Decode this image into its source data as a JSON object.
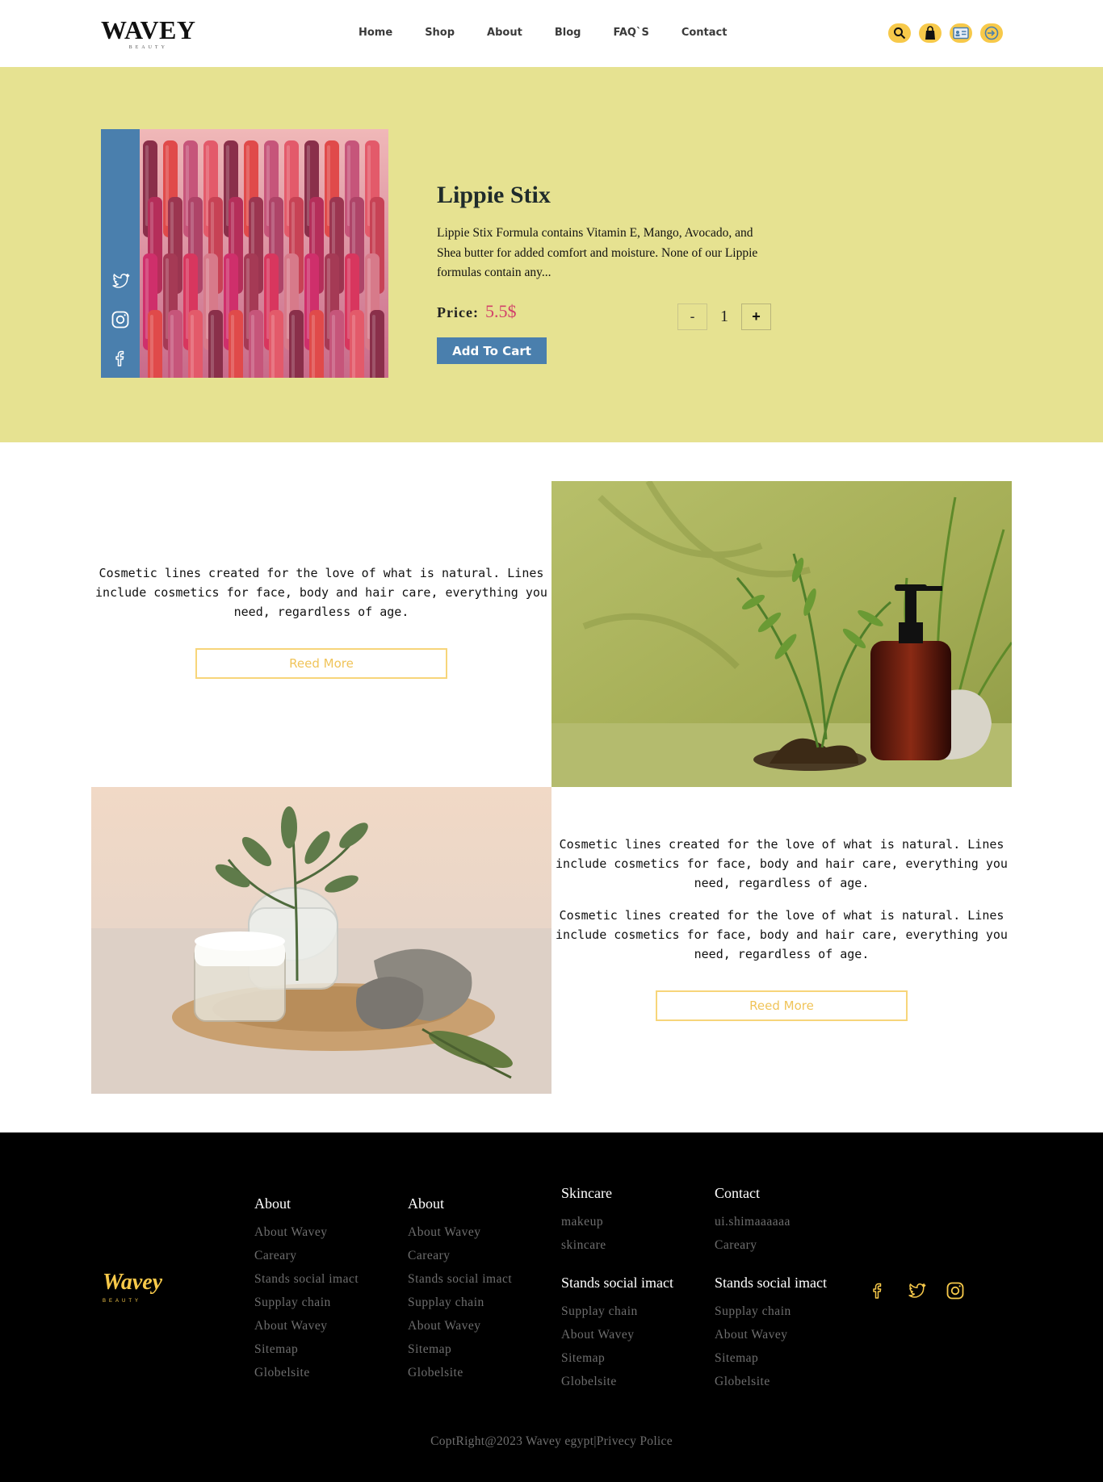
{
  "brand": {
    "name": "WAVEY",
    "tagline": "BEAUTY"
  },
  "nav": {
    "items": [
      "Home",
      "Shop",
      "About",
      "Blog",
      "FAQ`S",
      "Contact"
    ]
  },
  "header_icons": [
    "search-icon",
    "bag-icon",
    "id-card-icon",
    "login-icon"
  ],
  "product": {
    "title": "Lippie Stix",
    "description": "Lippie Stix Formula contains Vitamin E, Mango, Avocado, and Shea butter for added comfort and moisture. None of our Lippie formulas contain any...",
    "price_label": "Price:",
    "price_value": "5.5$",
    "quantity": "1",
    "minus_label": "-",
    "plus_label": "+",
    "cart_label": "Add To Cart"
  },
  "sections": {
    "block1_text": "Cosmetic lines created for the love of what is natural. Lines include cosmetics for face, body and hair care, everything you need, regardless of age.",
    "block1_button": "Reed More",
    "block2_text_a": "Cosmetic lines created for the love of what is natural. Lines include cosmetics for face, body and hair care, everything you need, regardless of age.",
    "block2_text_b": "Cosmetic lines created for the love of what is natural. Lines include cosmetics for face, body and hair care, everything you need, regardless of age.",
    "block2_button": "Reed More"
  },
  "footer": {
    "logo": "Wavey",
    "logo_sub": "BEAUTY",
    "col1": {
      "title": "About",
      "links": [
        "About Wavey",
        "Careary",
        "Stands social imact",
        "Supplay chain",
        "About Wavey",
        "Sitemap",
        "Globelsite"
      ]
    },
    "col2": {
      "title": "About",
      "links": [
        "About Wavey",
        "Careary",
        "Stands social imact",
        "Supplay chain",
        "About Wavey",
        "Sitemap",
        "Globelsite"
      ]
    },
    "col3": {
      "title": "Skincare",
      "links": [
        "makeup",
        "skincare"
      ],
      "title2": "Stands social imact",
      "links2": [
        "Supplay chain",
        "About Wavey",
        "Sitemap",
        "Globelsite"
      ]
    },
    "col4": {
      "title": "Contact",
      "links": [
        "ui.shimaaaaaa",
        "Careary"
      ],
      "title2": "Stands social imact",
      "links2": [
        "Supplay chain",
        "About Wavey",
        "Sitemap",
        "Globelsite"
      ]
    },
    "copyright": "CoptRight@2023 Wavey egypt|Privecy Police"
  },
  "colors": {
    "accent": "#f7c94a",
    "hero_bg": "#e6e291",
    "blue": "#4a7fad",
    "price": "#d2416a"
  }
}
